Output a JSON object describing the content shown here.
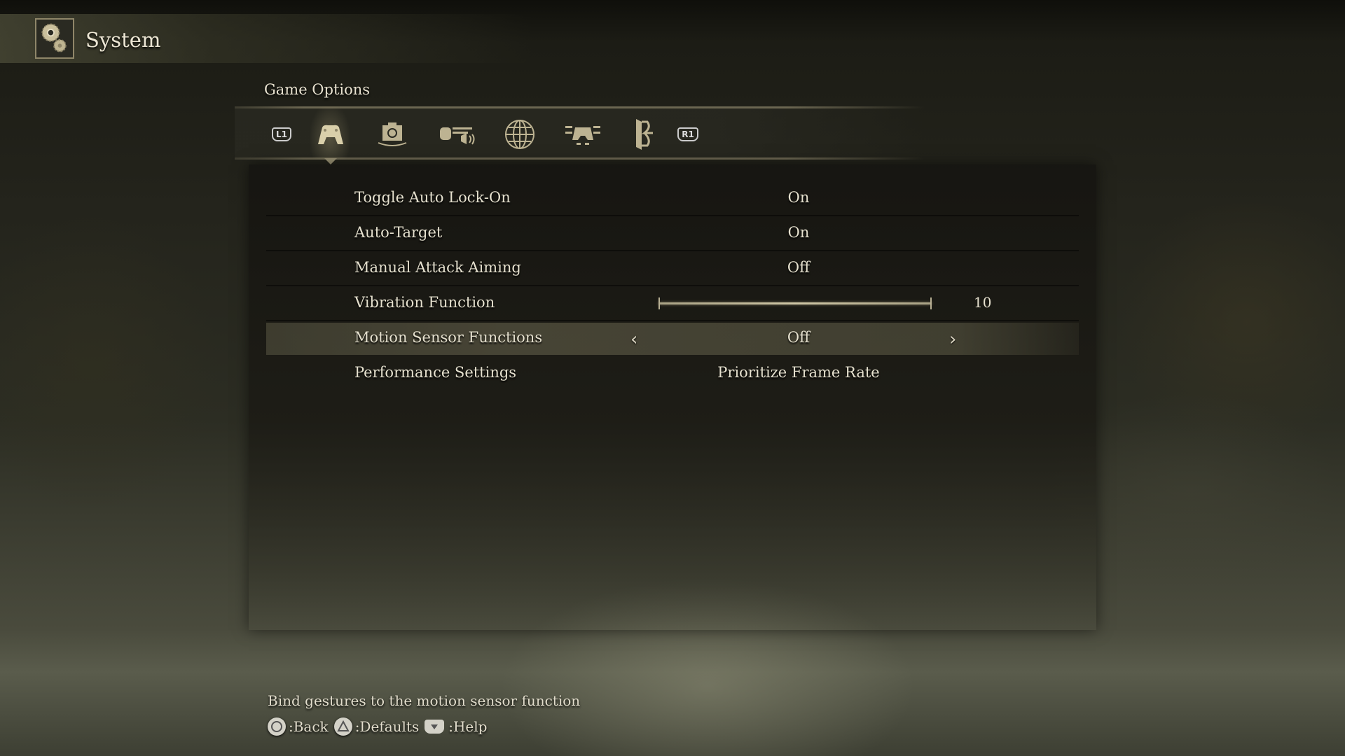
{
  "header": {
    "title": "System",
    "icon": "gears-icon"
  },
  "section": {
    "title": "Game Options"
  },
  "tabs": {
    "prev_button": "L1",
    "next_button": "R1",
    "items": [
      {
        "name": "game-options",
        "icon": "controller-icon",
        "active": true
      },
      {
        "name": "camera",
        "icon": "camera-icon",
        "active": false
      },
      {
        "name": "sound",
        "icon": "sound-icon",
        "active": false
      },
      {
        "name": "network",
        "icon": "globe-icon",
        "active": false
      },
      {
        "name": "key-config",
        "icon": "controller-config-icon",
        "active": false
      },
      {
        "name": "quit",
        "icon": "exit-door-icon",
        "active": false
      }
    ]
  },
  "options": [
    {
      "label": "Toggle Auto Lock-On",
      "value": "On"
    },
    {
      "label": "Auto-Target",
      "value": "On"
    },
    {
      "label": "Manual Attack Aiming",
      "value": "Off"
    },
    {
      "label": "Vibration Function",
      "value": "10",
      "type": "slider",
      "slider_level": 10,
      "slider_max": 10
    },
    {
      "label": "Motion Sensor Functions",
      "value": "Off",
      "selected": true
    },
    {
      "label": "Performance Settings",
      "value": "Prioritize Frame Rate"
    }
  ],
  "footer": {
    "description": "Bind gestures to the motion sensor function",
    "hints": [
      {
        "button": "circle-button",
        "label": ":Back"
      },
      {
        "button": "triangle-button",
        "label": ":Defaults"
      },
      {
        "button": "touchpad-button",
        "label": ":Help"
      }
    ]
  },
  "colors": {
    "accent": "#c8bf9c",
    "text": "#e6e1cf",
    "panel": "#1c1b15"
  }
}
